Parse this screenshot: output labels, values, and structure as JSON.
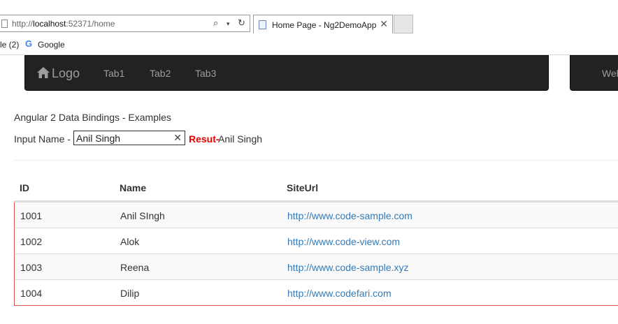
{
  "browser": {
    "url_prefix": "http://",
    "url_host": "localhost",
    "url_rest": ":52371/home",
    "tab_title": "Home Page - Ng2DemoApp",
    "favorites": [
      "le (2)",
      "Google"
    ],
    "google_letter": "G"
  },
  "navbar": {
    "brand": "Logo",
    "tabs": [
      "Tab1",
      "Tab2",
      "Tab3"
    ],
    "right_text": "Wel"
  },
  "content": {
    "heading": "Angular 2 Data Bindings - Examples",
    "input_label": "Input Name -",
    "input_value": "Anil Singh",
    "result_label": "Resut-",
    "result_value": "Anil Singh"
  },
  "table": {
    "headers": [
      "ID",
      "Name",
      "SiteUrl"
    ],
    "rows": [
      {
        "id": "1001",
        "name": "Anil SIngh",
        "url": "http://www.code-sample.com"
      },
      {
        "id": "1002",
        "name": "Alok",
        "url": "http://www.code-view.com"
      },
      {
        "id": "1003",
        "name": "Reena",
        "url": "http://www.code-sample.xyz"
      },
      {
        "id": "1004",
        "name": "Dilip",
        "url": "http://www.codefari.com"
      }
    ]
  },
  "colors": {
    "navbar_bg": "#222222",
    "result_label": "#ee0000",
    "link": "#337ab7",
    "row_border": "#d9534f"
  }
}
